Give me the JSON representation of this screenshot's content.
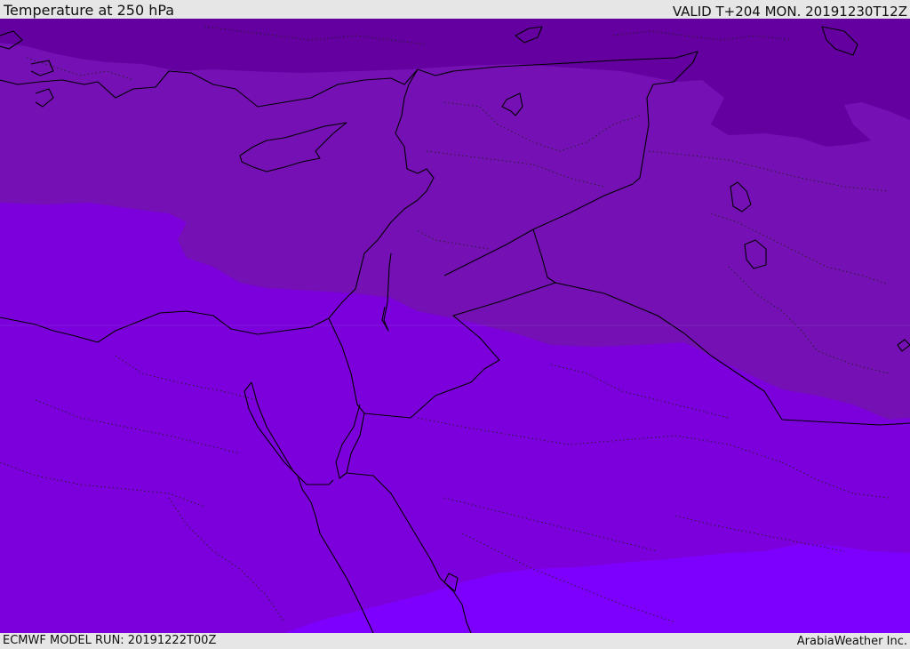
{
  "header": {
    "title": "Temperature at 250 hPa",
    "valid": "VALID T+204 MON. 20191230T12Z"
  },
  "footer": {
    "model_run": "ECMWF MODEL RUN: 20191222T00Z",
    "credit": "ArabiaWeather Inc."
  },
  "map": {
    "field": "temperature",
    "level": "250 hPa",
    "color_bands": [
      "#6400a0",
      "#7410b4",
      "#7c00dc",
      "#7d00ff"
    ]
  }
}
